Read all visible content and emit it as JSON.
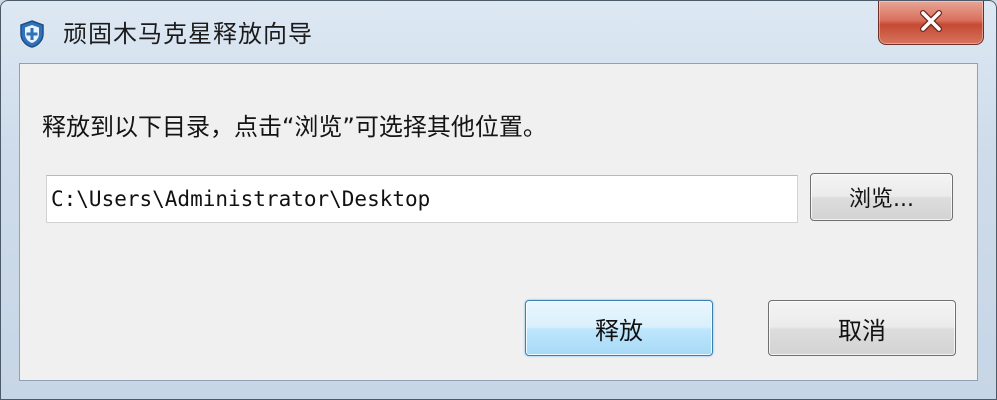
{
  "window": {
    "title": "顽固木马克星释放向导",
    "app_icon": "shield-icon",
    "close_icon": "close-icon"
  },
  "dialog": {
    "instruction": "释放到以下目录，点击“浏览”可选择其他位置。",
    "path_value": "C:\\Users\\Administrator\\Desktop",
    "browse_label": "浏览...",
    "release_label": "释放",
    "cancel_label": "取消"
  },
  "colors": {
    "close_button": "#c44a33",
    "default_button_border": "#3c7fb1",
    "shield_icon": "#2f72b8"
  }
}
